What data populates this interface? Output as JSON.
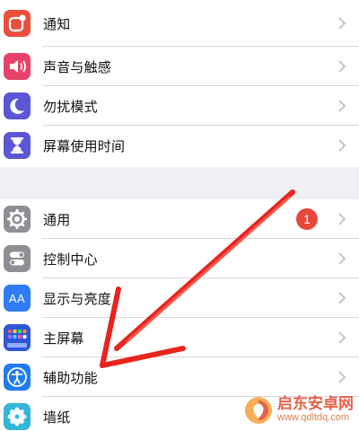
{
  "settings": {
    "group1": [
      {
        "label": "通知",
        "icon": "notifications-icon",
        "icon_bg": "#ea4f3d"
      },
      {
        "label": "声音与触感",
        "icon": "sound-icon",
        "icon_bg": "#e8416a"
      },
      {
        "label": "勿扰模式",
        "icon": "moon-icon",
        "icon_bg": "#5a56d6"
      },
      {
        "label": "屏幕使用时间",
        "icon": "hourglass-icon",
        "icon_bg": "#5a56d6"
      }
    ],
    "group2": [
      {
        "label": "通用",
        "icon": "gear-icon",
        "icon_bg": "#8e8e93",
        "badge": "1"
      },
      {
        "label": "控制中心",
        "icon": "toggles-icon",
        "icon_bg": "#8e8e93"
      },
      {
        "label": "显示与亮度",
        "icon": "display-icon",
        "icon_bg": "#2f7cf6",
        "icon_text": "AA"
      },
      {
        "label": "主屏幕",
        "icon": "home-screen-icon",
        "icon_bg": "#2f57d8"
      },
      {
        "label": "辅助功能",
        "icon": "accessibility-icon",
        "icon_bg": "#1f7cf0"
      },
      {
        "label": "墙纸",
        "icon": "wallpaper-icon",
        "icon_bg": "#33b7d8"
      }
    ]
  },
  "annotation": {
    "arrow_color": "#e8241e"
  },
  "watermark": {
    "name": "启东安卓网",
    "url": "www.qdltdq.com",
    "accent": "#e0472c"
  }
}
